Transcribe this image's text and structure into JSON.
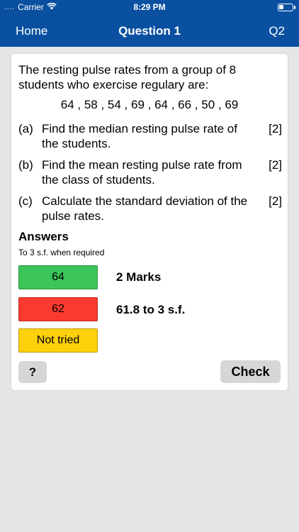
{
  "status_bar": {
    "dots": "....",
    "carrier": "Carrier",
    "time": "8:29 PM"
  },
  "nav": {
    "home": "Home",
    "title": "Question 1",
    "next": "Q2"
  },
  "question": {
    "text": "The resting pulse rates from a group of 8 students who exercise regulary are:",
    "values": "64 , 58 , 54 , 69 , 64 , 66 , 50 , 69",
    "parts": [
      {
        "letter": "(a)",
        "text": "Find the median resting pulse rate of the students.",
        "marks": "[2]"
      },
      {
        "letter": "(b)",
        "text": "Find the mean resting pulse rate from the class of students.",
        "marks": "[2]"
      },
      {
        "letter": "(c)",
        "text": "Calculate the standard deviation of the pulse rates.",
        "marks": "[2]"
      }
    ]
  },
  "answers": {
    "heading": "Answers",
    "note": "To 3 s.f. when required",
    "items": [
      {
        "value": "64",
        "label": "2 Marks",
        "color": "#3cc55a"
      },
      {
        "value": "62",
        "label": "61.8 to 3 s.f.",
        "color": "#fb3a2f"
      },
      {
        "value": "Not tried",
        "color": "#fcd00a"
      }
    ]
  },
  "buttons": {
    "help": "?",
    "check": "Check"
  },
  "colors": {
    "brand": "#0a50a0",
    "background": "#e6e6e6"
  }
}
